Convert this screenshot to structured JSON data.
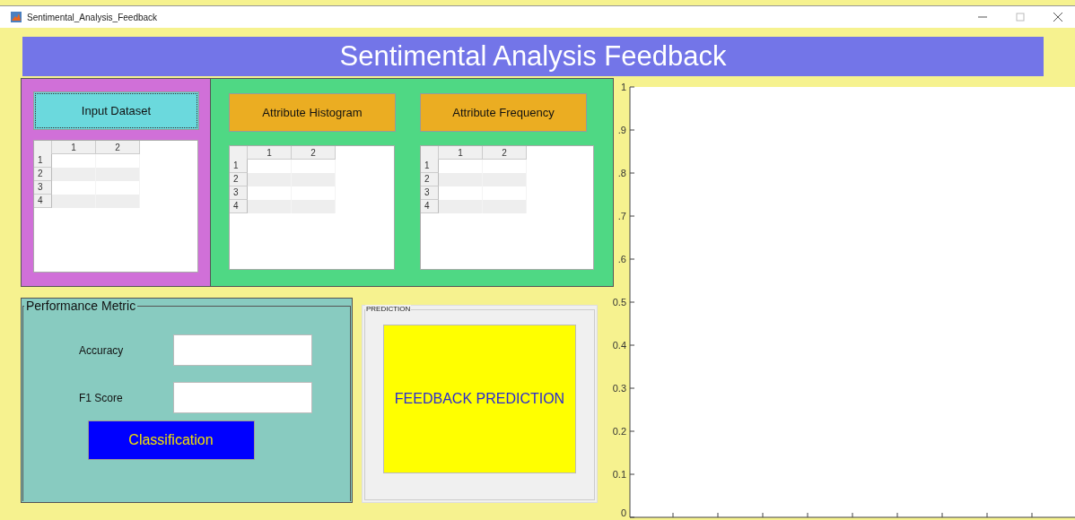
{
  "window": {
    "title": "Sentimental_Analysis_Feedback"
  },
  "banner": {
    "title": "Sentimental Analysis Feedback"
  },
  "input_panel": {
    "button": "Input Dataset",
    "button_focused": true,
    "table": {
      "columns": [
        "1",
        "2"
      ],
      "rows": [
        "1",
        "2",
        "3",
        "4"
      ]
    }
  },
  "attribute_panel": {
    "sections": [
      {
        "button": "Attribute Histogram",
        "table": {
          "columns": [
            "1",
            "2"
          ],
          "rows": [
            "1",
            "2",
            "3",
            "4"
          ]
        }
      },
      {
        "button": "Attribute Frequency",
        "table": {
          "columns": [
            "1",
            "2"
          ],
          "rows": [
            "1",
            "2",
            "3",
            "4"
          ]
        }
      }
    ]
  },
  "performance_metric": {
    "title": "Performance Metric",
    "fields": [
      {
        "label": "Accuracy"
      },
      {
        "label": "F1 Score"
      }
    ],
    "button": "Classification"
  },
  "prediction": {
    "title": "PREDICTION",
    "button": "FEEDBACK PREDICTION"
  },
  "chart": {
    "chart_data": {
      "type": "line",
      "categories": [
        null,
        null,
        null,
        null,
        null,
        null,
        null,
        null,
        null
      ],
      "series": [
        {
          "values": [
            null,
            null,
            null,
            null,
            null,
            null,
            null,
            null,
            null
          ]
        }
      ],
      "ylim": [
        0,
        1
      ],
      "yticks": [
        {
          "value": 0,
          "label": "0"
        },
        {
          "value": 0.1,
          "label": "0.1"
        },
        {
          "value": 0.2,
          "label": "0.2"
        },
        {
          "value": 0.3,
          "label": "0.3"
        },
        {
          "value": 0.4,
          "label": "0.4"
        },
        {
          "value": 0.5,
          "label": "0.5"
        },
        {
          "value": 0.6,
          "label": ".6"
        },
        {
          "value": 0.7,
          "label": ".7"
        },
        {
          "value": 0.8,
          "label": ".8"
        },
        {
          "value": 0.9,
          "label": ".9"
        },
        {
          "value": 1,
          "label": "1"
        }
      ]
    }
  }
}
